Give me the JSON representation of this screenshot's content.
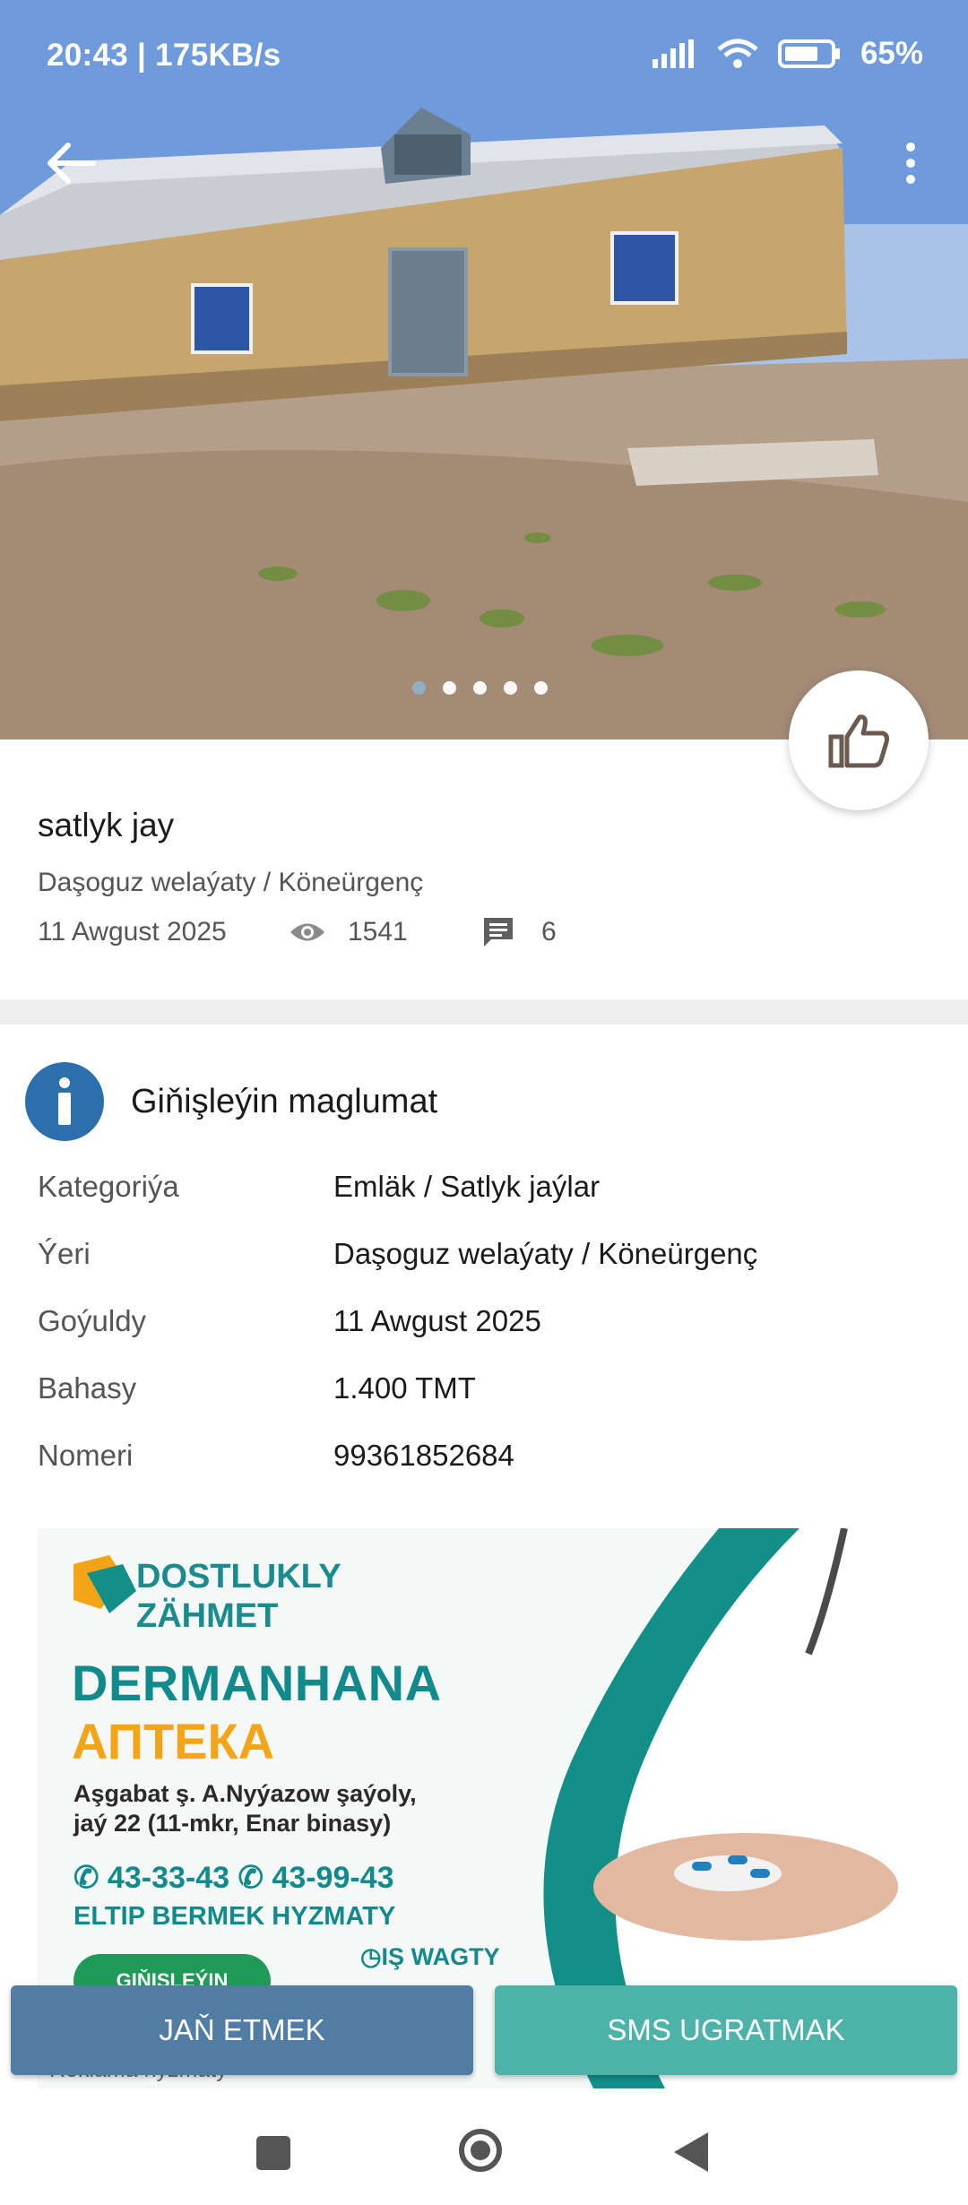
{
  "status_bar": {
    "time_speed": "20:43 | 175KB/s",
    "battery": "65%"
  },
  "listing": {
    "title": "satlyk jay",
    "location": "Daşoguz welaýaty / Köneürgenç",
    "date": "11 Awgust 2025",
    "views": "1541",
    "comments": "6",
    "photo_count": 5,
    "active_photo": 1
  },
  "details": {
    "heading": "Giňişleýin maglumat",
    "rows": [
      {
        "key": "Kategoriýa",
        "value": "Emläk / Satlyk jaýlar"
      },
      {
        "key": "Ýeri",
        "value": "Daşoguz welaýaty / Köneürgenç"
      },
      {
        "key": "Goýuldy",
        "value": "11 Awgust 2025"
      },
      {
        "key": "Bahasy",
        "value": "1.400 TMT"
      },
      {
        "key": "Nomeri",
        "value": "99361852684"
      }
    ]
  },
  "ad": {
    "brand_line1": "DOSTLUKLY",
    "brand_line2": "ZÄHMET",
    "title1": "DERMANHANA",
    "title2": "АПТЕКА",
    "address_line1": "Aşgabat ş. A.Nyýazow şaýoly,",
    "address_line2": "jaý 22 (11-mkr, Enar binasy)",
    "phones": "✆ 43-33-43  ✆ 43-99-43",
    "delivery": "ELTIP BERMEK HYZMATY",
    "more_label": "GIŇIŞLEÝIN",
    "hours_label": "◷IŞ WAGTY",
    "caption": "Reklama hyzmaty"
  },
  "actions": {
    "call_label": "JAŇ ETMEK",
    "sms_label": "SMS UGRATMAK"
  },
  "colors": {
    "call_button": "#517ca4",
    "sms_button": "#4db3a9",
    "info_icon": "#2c6fad"
  }
}
